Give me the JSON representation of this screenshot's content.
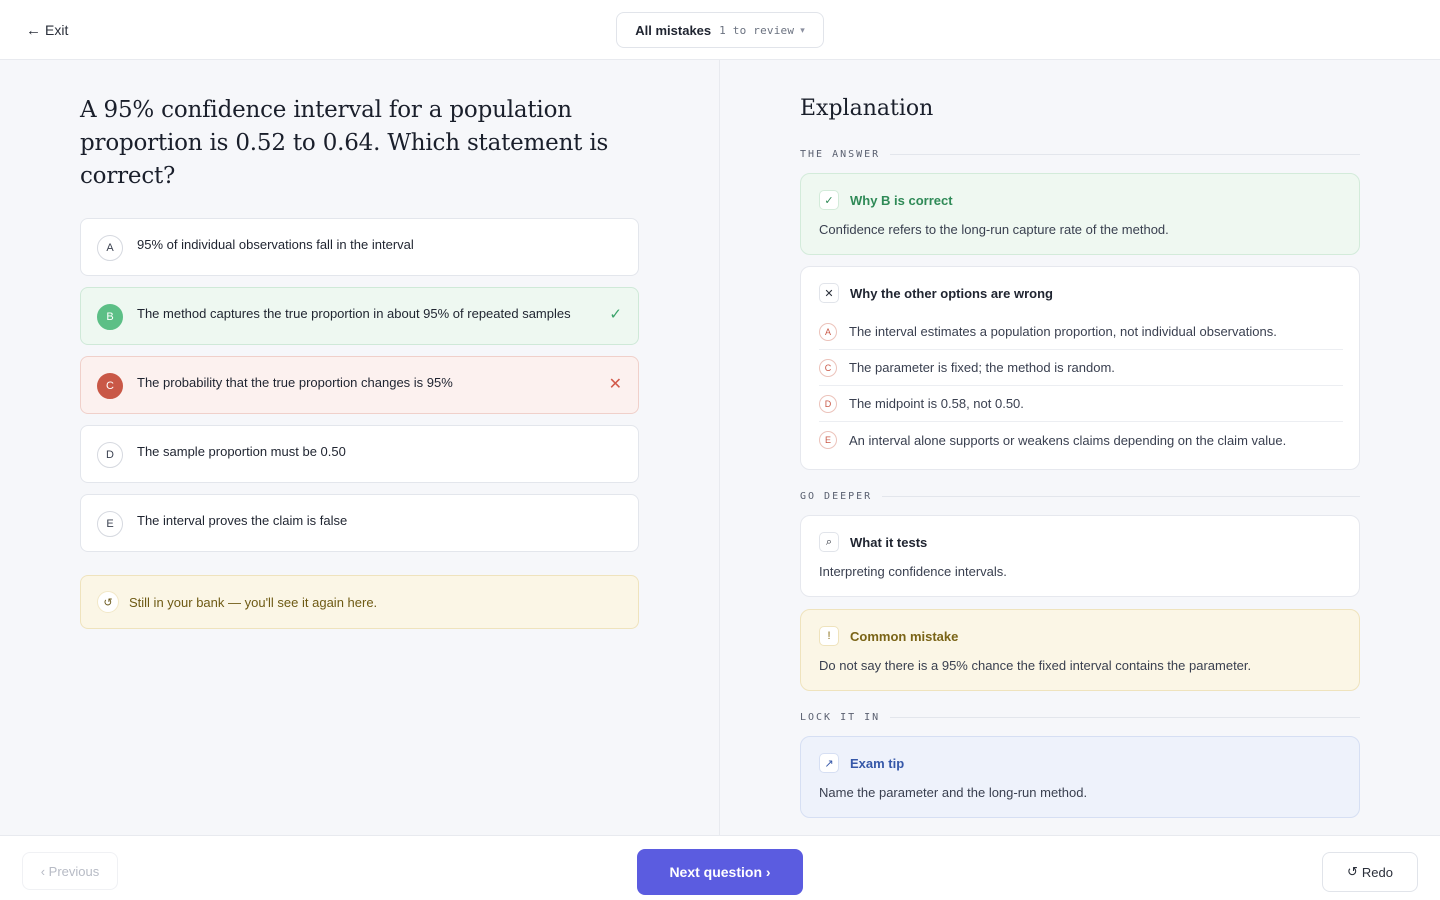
{
  "header": {
    "exit_icon": "←",
    "exit_label": "Exit",
    "filter": {
      "title": "All mistakes",
      "count": "1 to review",
      "caret": "▾"
    }
  },
  "question": {
    "text": "A 95% confidence interval for a population proportion is 0.52 to 0.64. Which statement is correct?",
    "options": [
      {
        "letter": "A",
        "text": "95% of individual observations fall in the interval",
        "state": "neutral"
      },
      {
        "letter": "B",
        "text": "The method captures the true proportion in about 95% of repeated samples",
        "state": "correct",
        "mark": "✓"
      },
      {
        "letter": "C",
        "text": "The probability that the true proportion changes is 95%",
        "state": "wrong",
        "mark": "✕"
      },
      {
        "letter": "D",
        "text": "The sample proportion must be 0.50",
        "state": "neutral"
      },
      {
        "letter": "E",
        "text": "The interval proves the claim is false",
        "state": "neutral"
      }
    ],
    "bank_note": {
      "icon": "↺",
      "text": "Still in your bank — you'll see it again here."
    }
  },
  "explanation": {
    "title": "Explanation",
    "sections": {
      "answer": "THE ANSWER",
      "deeper": "GO DEEPER",
      "lock": "LOCK IT IN"
    },
    "why_correct": {
      "icon": "✓",
      "title": "Why B is correct",
      "body": "Confidence refers to the long-run capture rate of the method."
    },
    "why_wrong": {
      "icon": "✕",
      "title": "Why the other options are wrong",
      "items": [
        {
          "letter": "A",
          "text": "The interval estimates a population proportion, not individual observations."
        },
        {
          "letter": "C",
          "text": "The parameter is fixed; the method is random."
        },
        {
          "letter": "D",
          "text": "The midpoint is 0.58, not 0.50."
        },
        {
          "letter": "E",
          "text": "An interval alone supports or weakens claims depending on the claim value."
        }
      ]
    },
    "what_it_tests": {
      "icon": "⌕",
      "title": "What it tests",
      "body": "Interpreting confidence intervals."
    },
    "common_mistake": {
      "icon": "!",
      "title": "Common mistake",
      "body": "Do not say there is a 95% chance the fixed interval contains the parameter."
    },
    "exam_tip": {
      "icon": "↗",
      "title": "Exam tip",
      "body": "Name the parameter and the long-run method."
    }
  },
  "footer": {
    "previous_label": "‹ Previous",
    "next_label": "Next question ›",
    "redo_icon": "↺",
    "redo_label": "Redo"
  },
  "colors": {
    "accent": "#5b5ce0",
    "correct": "#5cbf86",
    "wrong": "#c95847",
    "note": "#fbf6e6",
    "tip": "#eef2fb"
  }
}
